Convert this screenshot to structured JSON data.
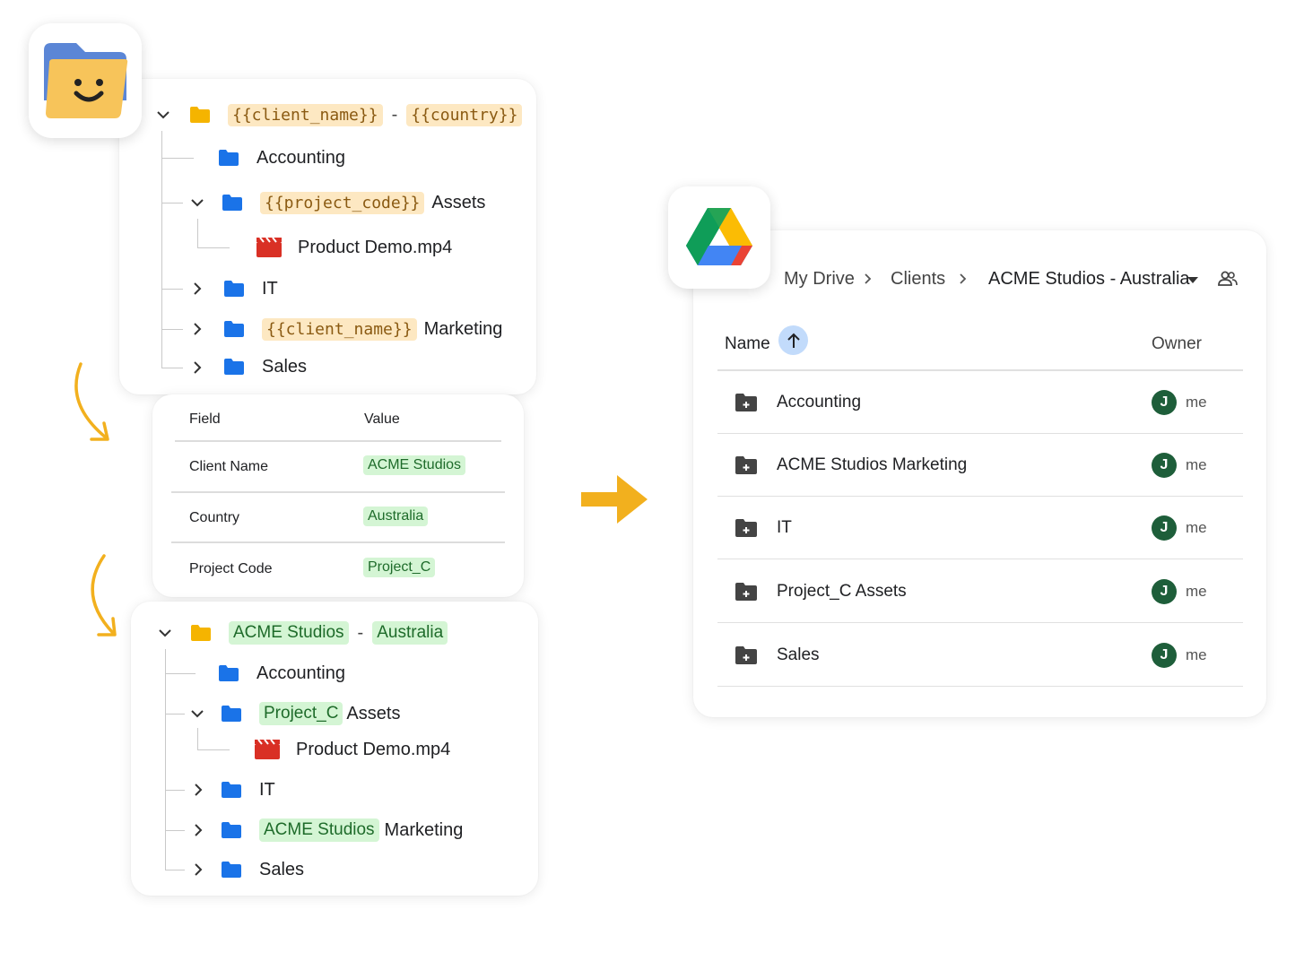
{
  "template_tree": {
    "root": {
      "token1": "{{client_name}}",
      "separator": "-",
      "token2": "{{country}}"
    },
    "accounting": "Accounting",
    "assets": {
      "token": "{{project_code}}",
      "suffix": "Assets"
    },
    "file": "Product Demo.mp4",
    "it": "IT",
    "marketing": {
      "token": "{{client_name}}",
      "suffix": "Marketing"
    },
    "sales": "Sales"
  },
  "fields": {
    "header_field": "Field",
    "header_value": "Value",
    "rows": [
      {
        "label": "Client Name",
        "value": "ACME Studios"
      },
      {
        "label": "Country",
        "value": "Australia"
      },
      {
        "label": "Project Code",
        "value": "Project_C"
      }
    ]
  },
  "result_tree": {
    "root": {
      "token1": "ACME Studios",
      "separator": "-",
      "token2": "Australia"
    },
    "accounting": "Accounting",
    "assets": {
      "token": "Project_C",
      "suffix": "Assets"
    },
    "file": "Product Demo.mp4",
    "it": "IT",
    "marketing": {
      "token": "ACME Studios",
      "suffix": "Marketing"
    },
    "sales": "Sales"
  },
  "drive": {
    "breadcrumbs": [
      "My Drive",
      "Clients",
      "ACME Studios - Australia"
    ],
    "col_name": "Name",
    "col_owner": "Owner",
    "rows": [
      {
        "name": "Accounting",
        "avatar": "J",
        "owner": "me"
      },
      {
        "name": "ACME Studios Marketing",
        "avatar": "J",
        "owner": "me"
      },
      {
        "name": "IT",
        "avatar": "J",
        "owner": "me"
      },
      {
        "name": "Project_C Assets",
        "avatar": "J",
        "owner": "me"
      },
      {
        "name": "Sales",
        "avatar": "J",
        "owner": "me"
      }
    ]
  },
  "colors": {
    "accent_orange": "#f2b01e",
    "folder_blue": "#1a73e8",
    "folder_yellow": "#f5b400",
    "token_yellow_bg": "#fde8c2",
    "token_green_bg": "#d4f5d4",
    "avatar_green": "#1e5e3a",
    "sort_chip": "#c2dbfb"
  },
  "icons": [
    "folder-app-icon",
    "google-drive-icon",
    "chevron-down-icon",
    "chevron-right-icon",
    "folder-icon",
    "video-file-icon",
    "dropdown-caret-icon",
    "share-people-icon",
    "sort-up-arrow-icon",
    "shared-folder-icon",
    "curved-arrow-icon",
    "right-arrow-icon"
  ]
}
